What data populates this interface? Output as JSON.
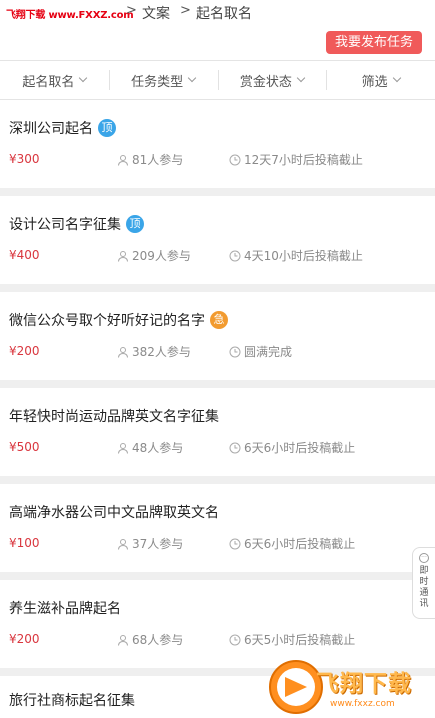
{
  "header": {
    "site_logo": "飞翔下载 www.FXXZ.com",
    "breadcrumb_sep": ">",
    "breadcrumb": [
      "文案",
      "起名取名"
    ],
    "publish_label": "我要发布任务"
  },
  "filters": [
    "起名取名",
    "任务类型",
    "赏金状态",
    "筛选"
  ],
  "tasks": [
    {
      "title": "深圳公司起名",
      "badge": "顶",
      "badge_type": "top",
      "reward": "¥300",
      "participants": "81人参与",
      "deadline": "12天7小时后投稿截止"
    },
    {
      "title": "设计公司名字征集",
      "badge": "顶",
      "badge_type": "top",
      "reward": "¥400",
      "participants": "209人参与",
      "deadline": "4天10小时后投稿截止"
    },
    {
      "title": "微信公众号取个好听好记的名字",
      "badge": "急",
      "badge_type": "urgent",
      "reward": "¥200",
      "participants": "382人参与",
      "deadline": "圆满完成"
    },
    {
      "title": "年轻快时尚运动品牌英文名字征集",
      "badge": "",
      "badge_type": "",
      "reward": "¥500",
      "participants": "48人参与",
      "deadline": "6天6小时后投稿截止"
    },
    {
      "title": "高端净水器公司中文品牌取英文名",
      "badge": "",
      "badge_type": "",
      "reward": "¥100",
      "participants": "37人参与",
      "deadline": "6天6小时后投稿截止"
    },
    {
      "title": "养生滋补品牌起名",
      "badge": "",
      "badge_type": "",
      "reward": "¥200",
      "participants": "68人参与",
      "deadline": "6天5小时后投稿截止"
    },
    {
      "title": "旅行社商标起名征集",
      "badge": "",
      "badge_type": "",
      "reward": "",
      "participants": "",
      "deadline": ""
    }
  ],
  "side_tab": {
    "label": "即时通讯",
    "icon": "chat-icon"
  },
  "watermark": {
    "text": "飞翔下载",
    "url": "www.fxxz.com",
    "icon": "fxxz-logo-icon"
  },
  "colors": {
    "accent": "#f05a5a",
    "reward": "#d9363e",
    "top_badge": "#3aa5e8",
    "urgent_badge": "#f29b30"
  }
}
